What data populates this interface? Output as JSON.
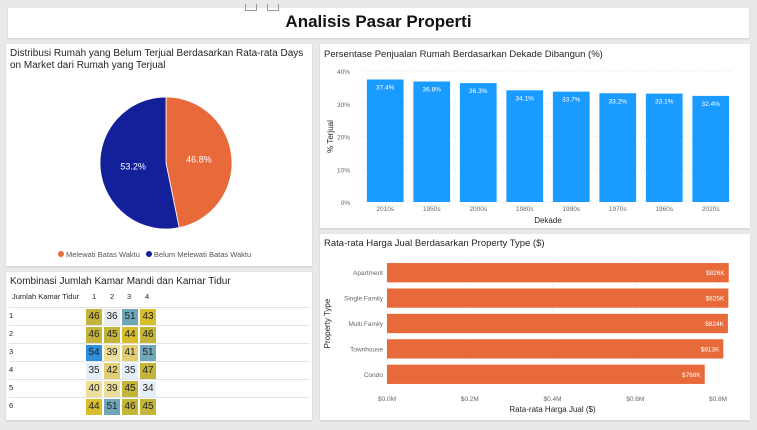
{
  "page": {
    "title": "Analisis Pasar Properti"
  },
  "colors": {
    "orange": "#E8693A",
    "navy": "#14209A",
    "blue": "#1A9BFF"
  },
  "pie": {
    "title_line1": "Distribusi Rumah yang Belum Terjual Berdasarkan Rata-rata Days",
    "title_line2": "on Market dari Rumah yang Terjual",
    "legend": [
      {
        "label": "Melewati Batas Waktu",
        "color": "#E8693A"
      },
      {
        "label": "Belum Melewati Batas Waktu",
        "color": "#14209A"
      }
    ],
    "labels": {
      "left": "53.2%",
      "right": "46.8%"
    }
  },
  "matrix": {
    "title": "Kombinasi Jumlah Kamar Mandi dan Kamar Tidur",
    "corner": "Jumlah Kamar Tidur",
    "col_headers": [
      "1",
      "2",
      "3",
      "4"
    ],
    "rows": [
      {
        "label": "1",
        "values": [
          "46",
          "36",
          "51",
          "43"
        ]
      },
      {
        "label": "2",
        "values": [
          "46",
          "45",
          "44",
          "46"
        ]
      },
      {
        "label": "3",
        "values": [
          "54",
          "39",
          "41",
          "51"
        ]
      },
      {
        "label": "4",
        "values": [
          "35",
          "42",
          "35",
          "47"
        ]
      },
      {
        "label": "5",
        "values": [
          "40",
          "39",
          "45",
          "34"
        ]
      },
      {
        "label": "6",
        "values": [
          "44",
          "51",
          "46",
          "45"
        ]
      }
    ]
  },
  "chart_data": [
    {
      "type": "pie",
      "title": "Distribusi Rumah yang Belum Terjual Berdasarkan Rata-rata Days on Market dari Rumah yang Terjual",
      "categories": [
        "Melewati Batas Waktu",
        "Belum Melewati Batas Waktu"
      ],
      "values": [
        46.8,
        53.2
      ],
      "data_labels": [
        "46.8%",
        "53.2%"
      ],
      "legend": "bottom"
    },
    {
      "type": "bar",
      "title": "Persentase Penjualan Rumah Berdasarkan Dekade Dibangun (%)",
      "xlabel": "Dekade",
      "ylabel": "% Terjual",
      "categories": [
        "2010s",
        "1950s",
        "2000s",
        "1980s",
        "1990s",
        "1970s",
        "1960s",
        "2020s"
      ],
      "values": [
        37.4,
        36.8,
        36.3,
        34.1,
        33.7,
        33.2,
        33.1,
        32.4
      ],
      "data_labels": [
        "37.4%",
        "36.8%",
        "36.3%",
        "34.1%",
        "33.7%",
        "33.2%",
        "33.1%",
        "32.4%"
      ],
      "yticks": [
        "0%",
        "10%",
        "20%",
        "30%",
        "40%"
      ],
      "ylim": [
        0,
        40
      ],
      "grid": true
    },
    {
      "type": "bar",
      "orientation": "horizontal",
      "title": "Rata-rata Harga Jual Berdasarkan Property Type ($)",
      "xlabel": "Rata-rata Harga Jual ($)",
      "ylabel": "Property Type",
      "categories": [
        "Apartment",
        "Single Family",
        "Multi Family",
        "Townhouse",
        "Condo"
      ],
      "values": [
        826000,
        825000,
        824000,
        813000,
        768000
      ],
      "data_labels": [
        "$826K",
        "$825K",
        "$824K",
        "$813K",
        "$768K"
      ],
      "xticks": [
        "$0.0M",
        "$0.2M",
        "$0.4M",
        "$0.6M",
        "$0.8M"
      ],
      "xlim": [
        0,
        800000
      ],
      "grid": true
    }
  ]
}
